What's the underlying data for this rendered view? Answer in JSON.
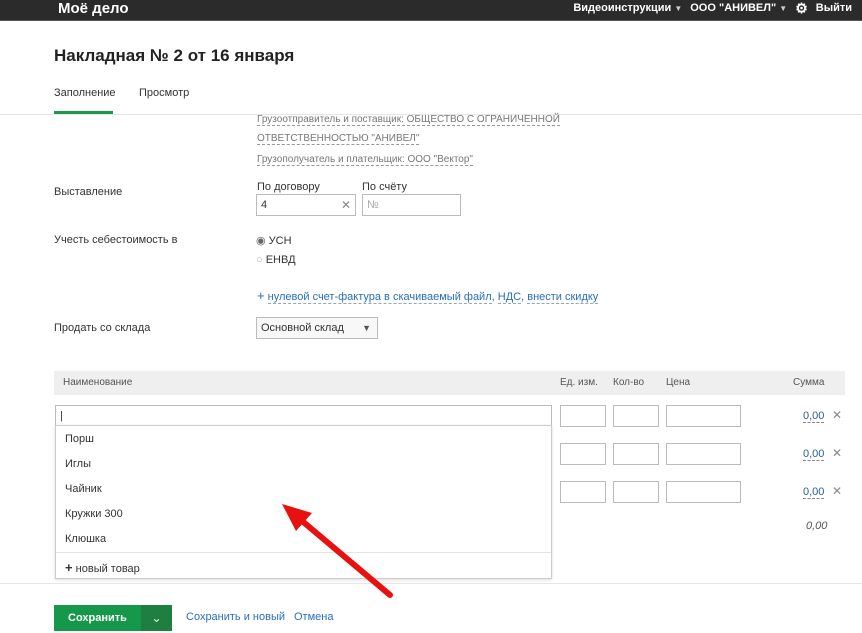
{
  "header": {
    "logo": "Моё дело",
    "videos": "Видеоинструкции",
    "company": "ООО \"АНИВЕЛ\"",
    "logout": "Выйти"
  },
  "page": {
    "title": "Накладная № 2 от 16 января",
    "tabs": [
      "Заполнение",
      "Просмотр"
    ]
  },
  "parties": {
    "shipper_line1": "Грузоотправитель и поставщик: ОБЩЕСТВО С ОГРАНИЧЕННОЙ",
    "shipper_line2": "ОТВЕТСТВЕННОСТЬЮ \"АНИВЕЛ\"",
    "consignee": "Грузополучатель и плательщик: ООО \"Вектор\""
  },
  "issue": {
    "label": "Выставление",
    "contract_label": "По договору",
    "contract_value": "4",
    "invoice_label": "По счёту",
    "invoice_placeholder": "№"
  },
  "cost": {
    "label": "Учесть себестоимость в",
    "options": [
      "УСН",
      "ЕНВД"
    ],
    "selected": "УСН"
  },
  "extras": {
    "plus": "+",
    "link1": "нулевой счет-фактура в скачиваемый файл",
    "link2": "НДС",
    "link3": "внести скидку"
  },
  "warehouse": {
    "label": "Продать со склада",
    "value": "Основной склад"
  },
  "table": {
    "headers": [
      "Наименование",
      "Ед. изм.",
      "Кол-во",
      "Цена",
      "Сумма"
    ],
    "rows": [
      {
        "sum": "0,00"
      },
      {
        "sum": "0,00"
      },
      {
        "sum": "0,00"
      }
    ],
    "total": "0,00"
  },
  "dropdown": {
    "items": [
      "Порш",
      "Иглы",
      "Чайник",
      "Кружки 300",
      "Клюшка"
    ],
    "new_item": "новый товар"
  },
  "footer": {
    "save": "Сохранить",
    "save_new": "Сохранить и новый",
    "cancel": "Отмена"
  }
}
